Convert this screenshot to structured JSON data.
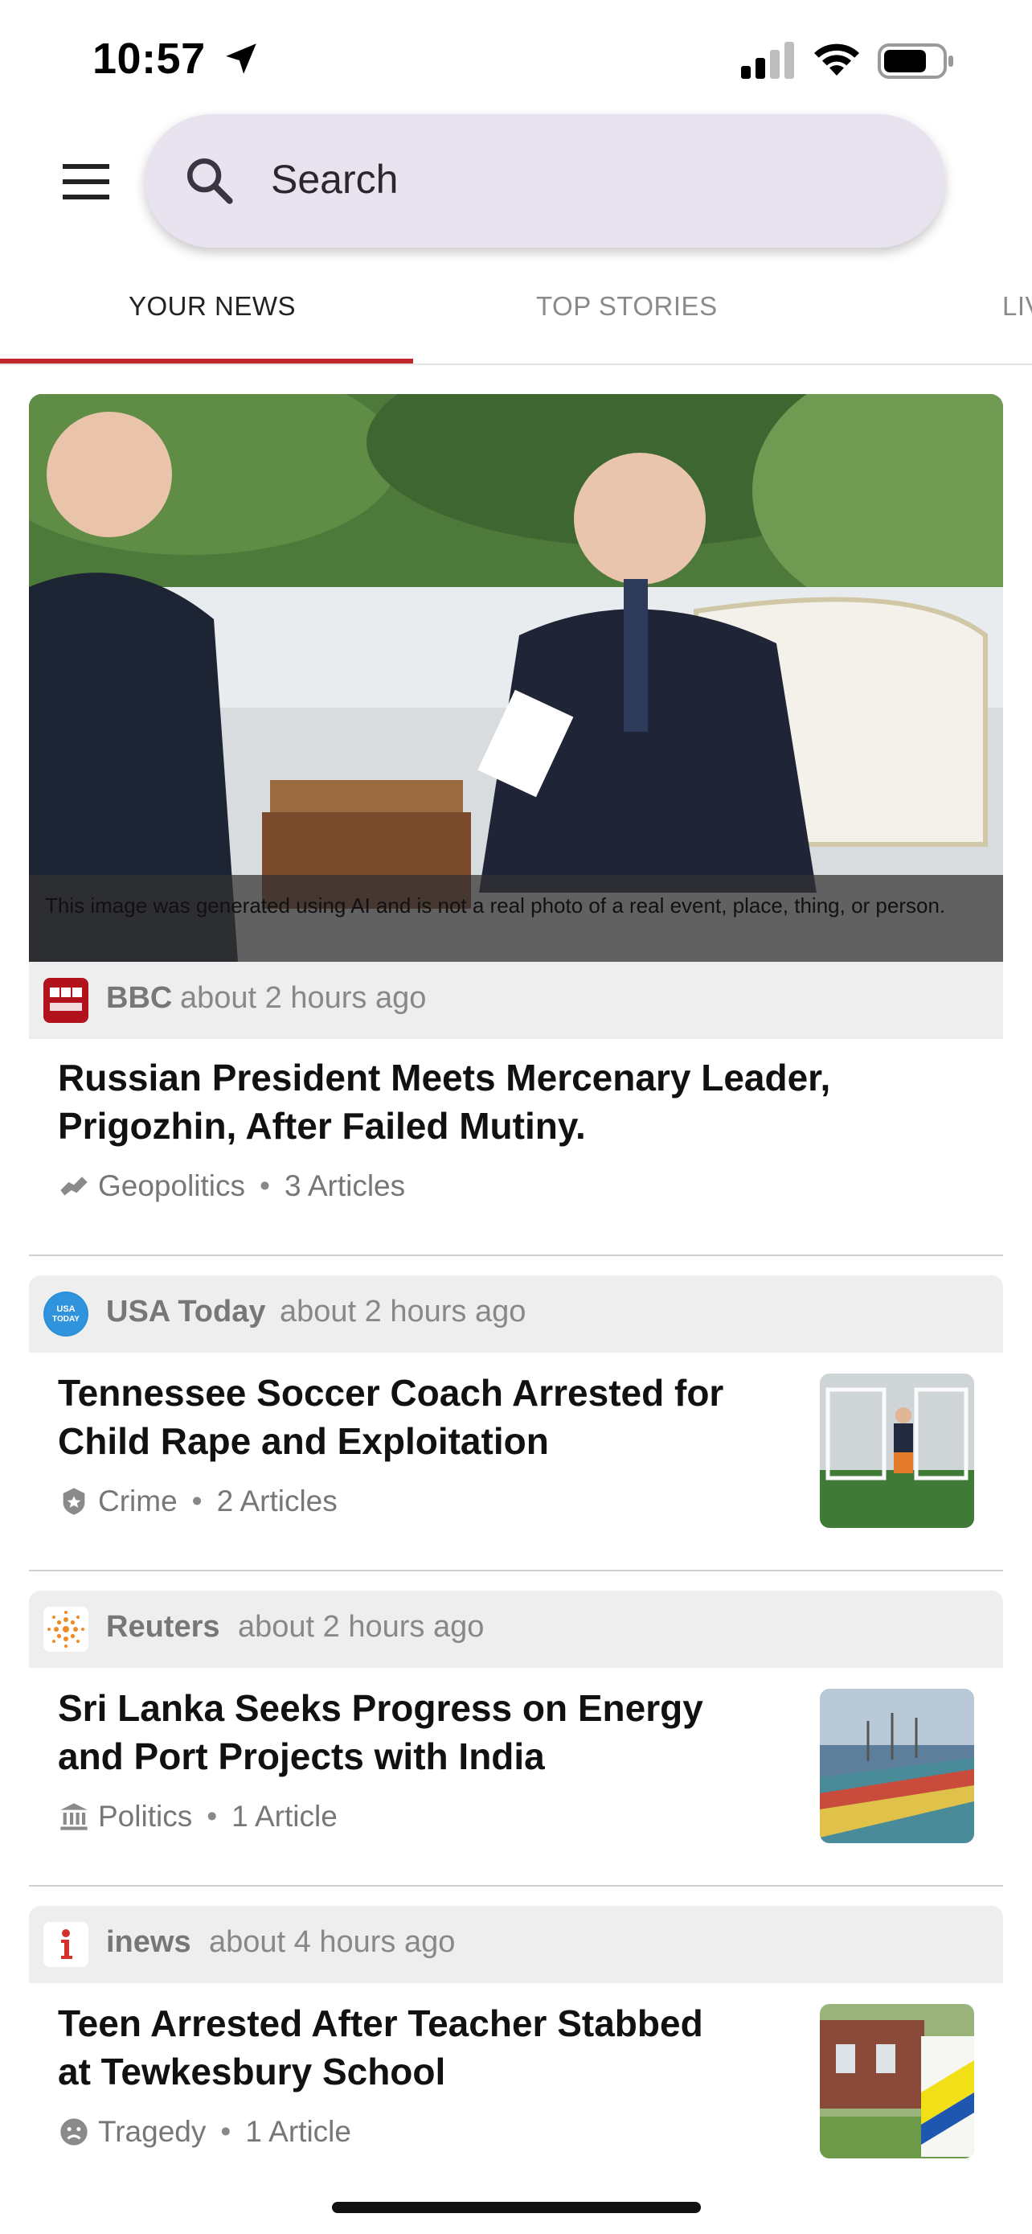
{
  "status_bar": {
    "time": "10:57"
  },
  "header": {
    "search_placeholder": "Search"
  },
  "tabs": [
    {
      "label": "YOUR NEWS",
      "active": true
    },
    {
      "label": "TOP STORIES",
      "active": false
    },
    {
      "label": "LIV",
      "active": false
    }
  ],
  "colors": {
    "accent": "#c0262c",
    "search_bg": "#e9e2ef",
    "source_bar_bg": "#eeeeee"
  },
  "feed": [
    {
      "source": "BBC",
      "time": "about 2 hours ago",
      "image_caption": "This image was generated using AI and is not a real photo of a real event, place, thing, or person.",
      "headline_line1": "Russian President Meets Mercenary Leader,",
      "headline_line2": "Prigozhin, After Failed Mutiny.",
      "topic": "Geopolitics",
      "articles": "3 Articles",
      "topic_icon": "handshake-icon"
    },
    {
      "source": "USA Today",
      "time": "about 2 hours ago",
      "headline_line1": "Tennessee Soccer Coach Arrested for",
      "headline_line2": "Child Rape and Exploitation",
      "topic": "Crime",
      "articles": "2 Articles",
      "topic_icon": "badge-icon"
    },
    {
      "source": "Reuters",
      "time": "about 2 hours ago",
      "headline_line1": "Sri Lanka Seeks Progress on Energy",
      "headline_line2": "and Port Projects with India",
      "topic": "Politics",
      "articles": "1 Article",
      "topic_icon": "government-building-icon"
    },
    {
      "source": "inews",
      "time": "about 4 hours ago",
      "headline_line1": "Teen Arrested After Teacher Stabbed",
      "headline_line2": "at Tewkesbury School",
      "topic": "Tragedy",
      "articles": "1 Article",
      "topic_icon": "tragedy-icon"
    }
  ]
}
